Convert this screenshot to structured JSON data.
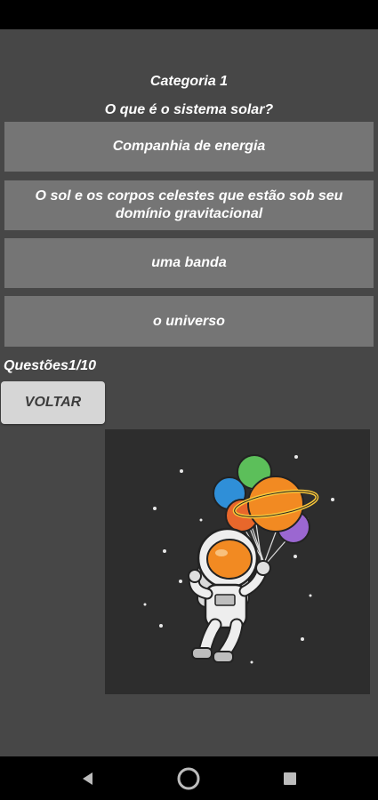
{
  "quiz": {
    "category": "Categoria 1",
    "question": "O que é o sistema solar?",
    "options": [
      "Companhia de energia",
      "O sol e os corpos celestes que estão sob seu domínio gravitacional",
      "uma banda",
      "o universo"
    ],
    "counter": "Questões1/10",
    "back_label": "VOLTAR"
  },
  "illustration": {
    "subject": "astronaut-with-planet-balloons-icon"
  },
  "nav": {
    "back": "back-icon",
    "home": "home-icon",
    "recents": "recents-icon"
  },
  "colors": {
    "background": "#474747",
    "option_button": "#757575",
    "back_button": "#d6d6d6",
    "illustration_bg": "#2d2d2d",
    "text": "#ffffff"
  }
}
